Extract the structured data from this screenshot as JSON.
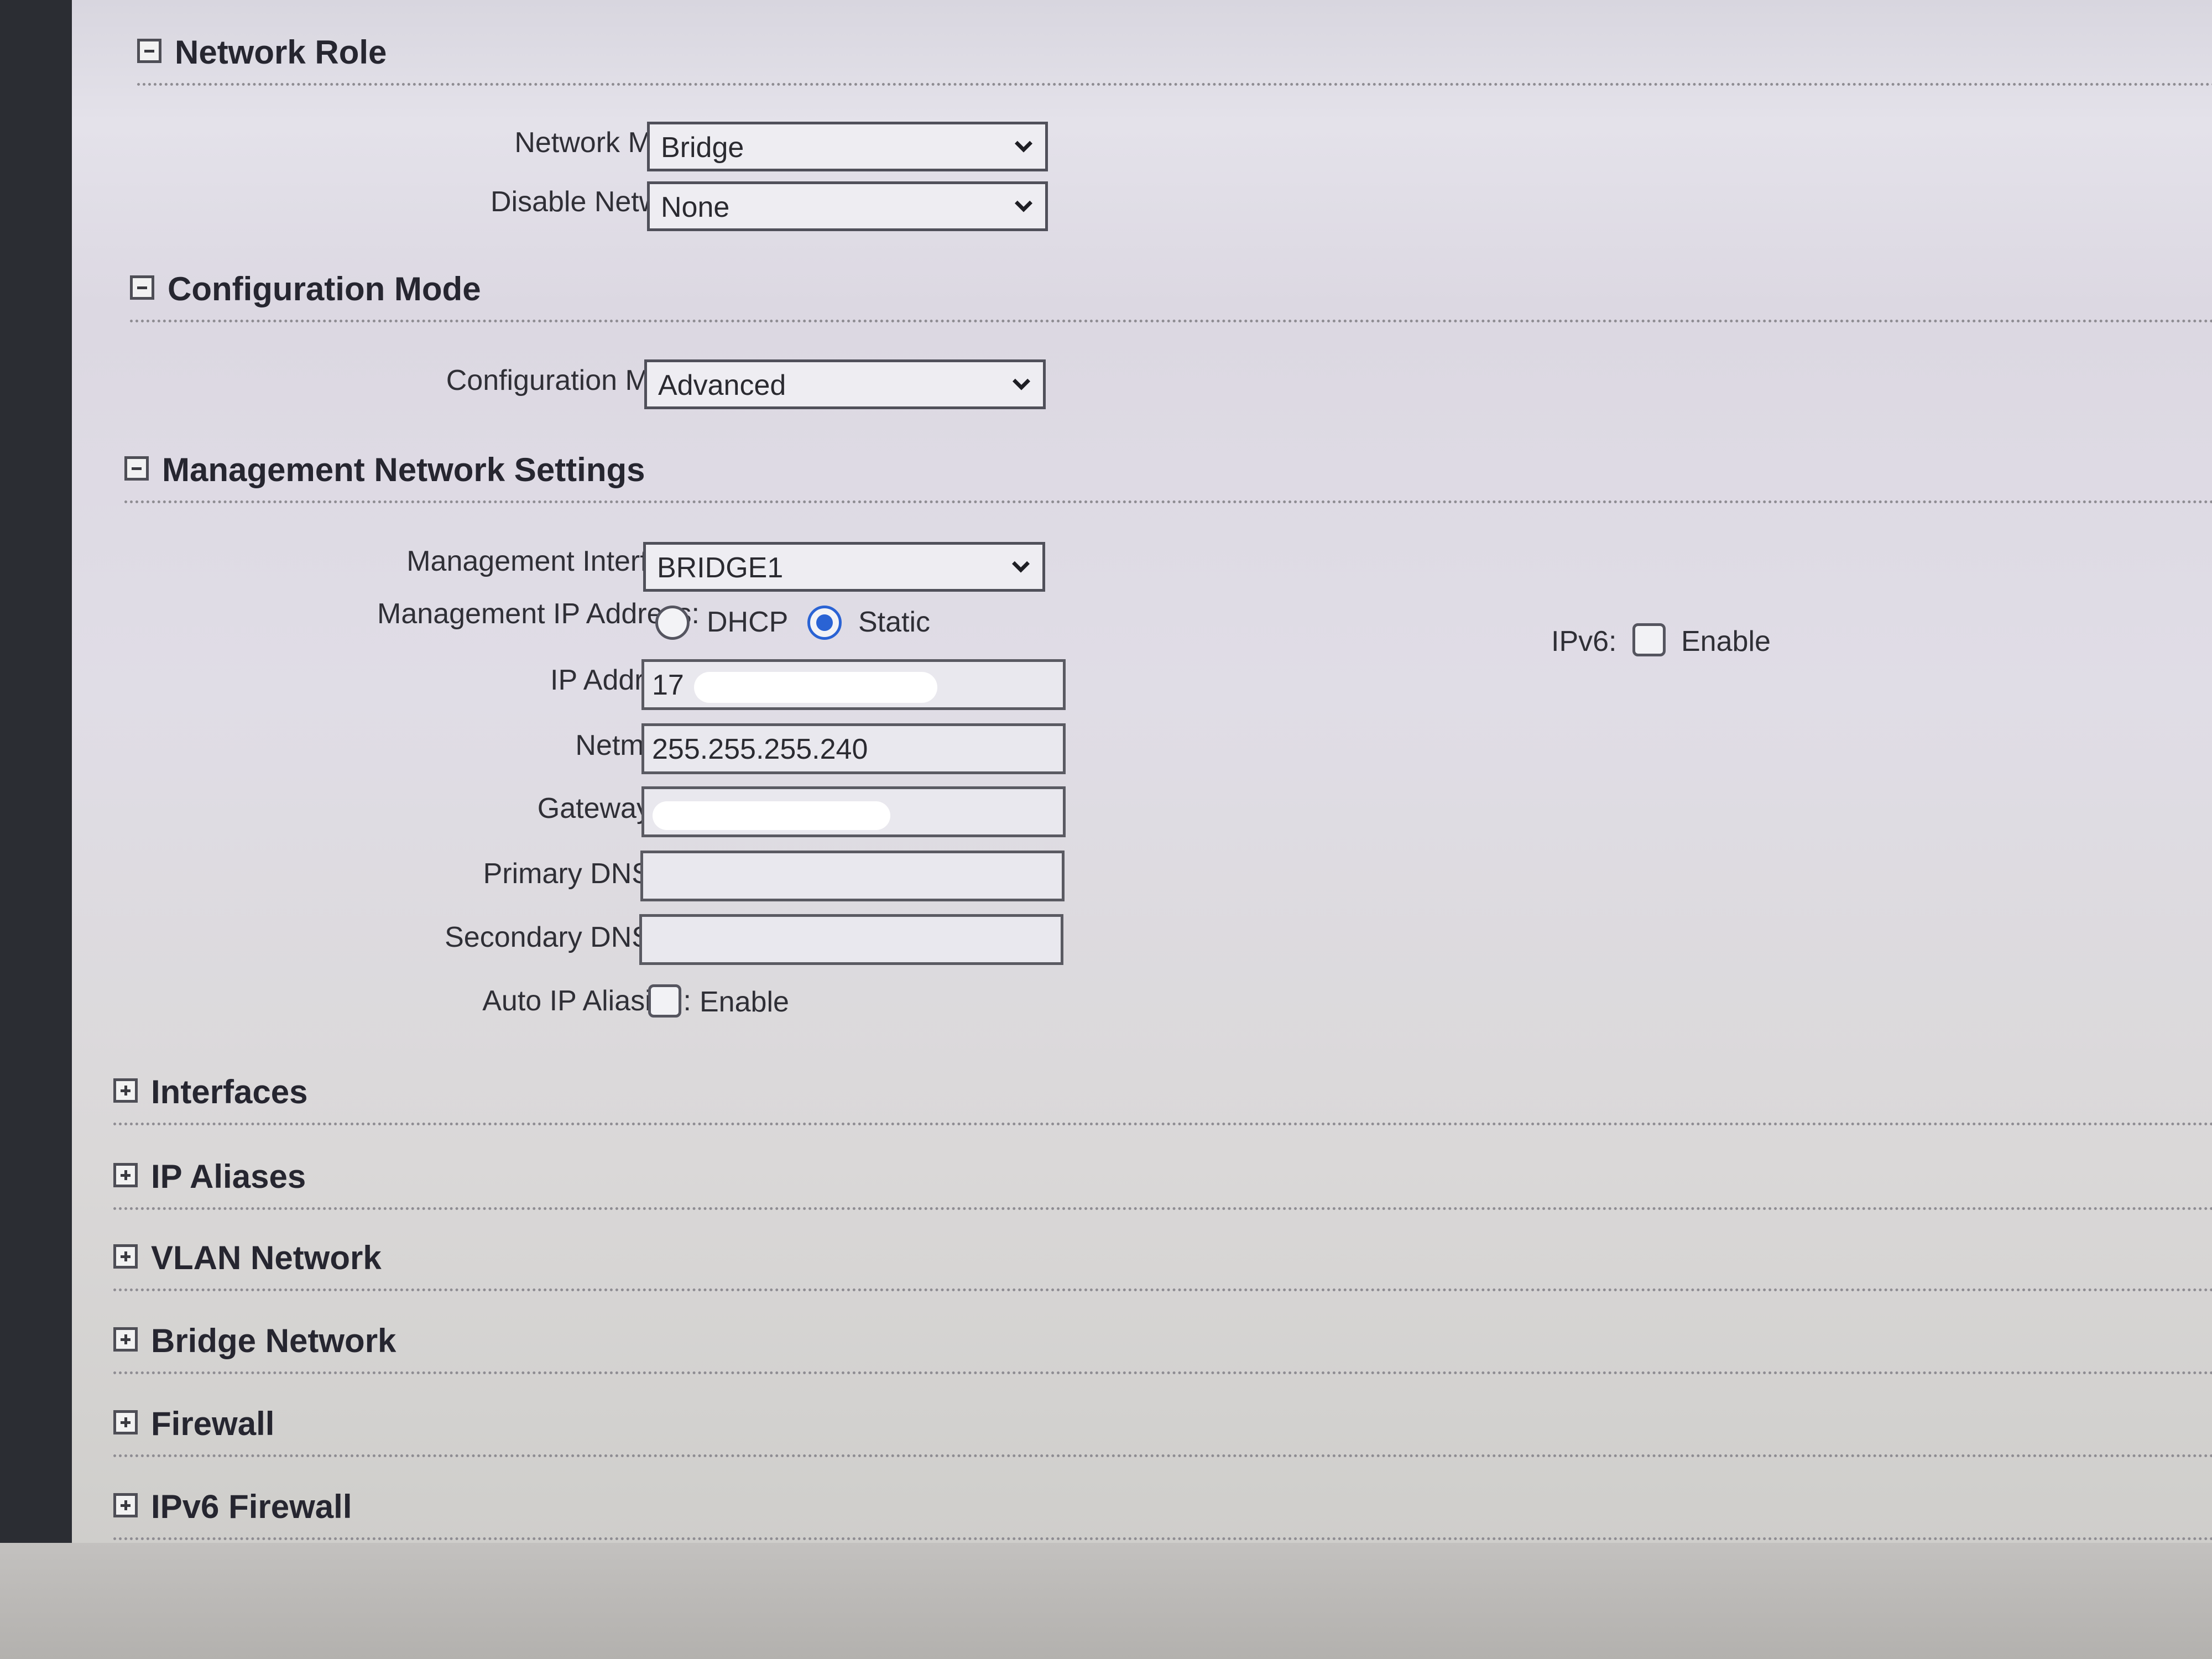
{
  "sections": {
    "network_role": {
      "title": "Network Role",
      "fields": {
        "network_mode": {
          "label": "Network Mode:",
          "value": "Bridge"
        },
        "disable_network": {
          "label": "Disable Network:",
          "value": "None"
        }
      }
    },
    "configuration_mode": {
      "title": "Configuration Mode",
      "fields": {
        "configuration_mode": {
          "label": "Configuration Mode:",
          "value": "Advanced"
        }
      }
    },
    "management_network": {
      "title": "Management Network Settings",
      "fields": {
        "management_interface": {
          "label": "Management Interface:",
          "value": "BRIDGE1"
        },
        "management_ip_address": {
          "label": "Management IP Address:",
          "options": [
            "DHCP",
            "Static"
          ],
          "selected": "Static"
        },
        "ip_address": {
          "label": "IP Address:",
          "value": "17"
        },
        "netmask": {
          "label": "Netmask:",
          "value": "255.255.255.240"
        },
        "gateway_ip": {
          "label": "Gateway IP:",
          "value": ""
        },
        "primary_dns_ip": {
          "label": "Primary DNS IP:",
          "value": ""
        },
        "secondary_dns_ip": {
          "label": "Secondary DNS IP:",
          "value": ""
        },
        "auto_ip_aliasing": {
          "label": "Auto IP Aliasing:",
          "option": "Enable",
          "checked": false
        },
        "ipv6": {
          "label": "IPv6:",
          "option": "Enable",
          "checked": false
        }
      }
    },
    "collapsed": [
      {
        "title": "Interfaces"
      },
      {
        "title": "IP Aliases"
      },
      {
        "title": "VLAN Network"
      },
      {
        "title": "Bridge Network"
      },
      {
        "title": "Firewall"
      },
      {
        "title": "IPv6 Firewall"
      }
    ]
  },
  "colors": {
    "radio_selected": "#2a63d4",
    "background": "#e0dde6"
  },
  "icons": {
    "expanded": "collapse-minus-icon",
    "collapsed": "expand-plus-icon",
    "select": "chevron-down-icon"
  }
}
